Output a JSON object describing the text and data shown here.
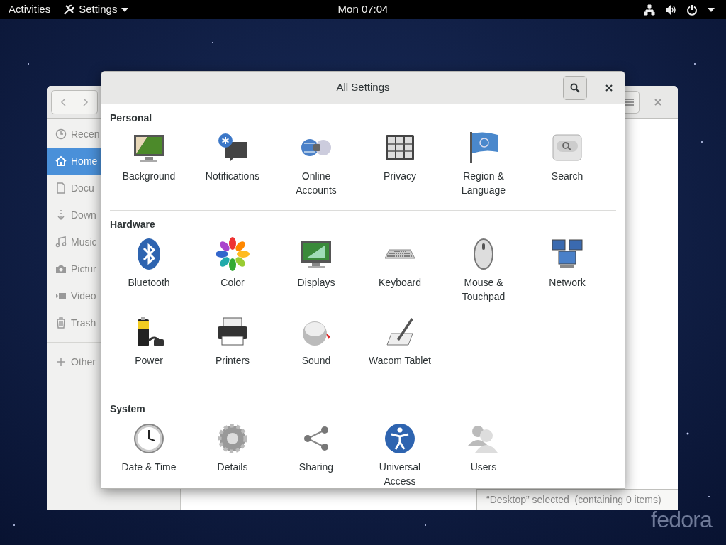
{
  "top_bar": {
    "activities": "Activities",
    "app_menu": "Settings",
    "clock": "Mon 07:04"
  },
  "files_window": {
    "sidebar": [
      {
        "label": "Recen",
        "selected": false
      },
      {
        "label": "Home",
        "selected": true
      },
      {
        "label": "Docu",
        "selected": false
      },
      {
        "label": "Down",
        "selected": false
      },
      {
        "label": "Music",
        "selected": false
      },
      {
        "label": "Pictur",
        "selected": false
      },
      {
        "label": "Video",
        "selected": false
      },
      {
        "label": "Trash",
        "selected": false
      },
      {
        "label": "Other",
        "selected": false
      }
    ],
    "status": "“Desktop” selected  (containing 0 items)"
  },
  "settings_dialog": {
    "title": "All Settings",
    "sections": [
      {
        "heading": "Personal",
        "items": [
          {
            "label": "Background"
          },
          {
            "label": "Notifications"
          },
          {
            "label": "Online Accounts"
          },
          {
            "label": "Privacy"
          },
          {
            "label": "Region & Language"
          },
          {
            "label": "Search"
          }
        ]
      },
      {
        "heading": "Hardware",
        "items": [
          {
            "label": "Bluetooth"
          },
          {
            "label": "Color"
          },
          {
            "label": "Displays"
          },
          {
            "label": "Keyboard"
          },
          {
            "label": "Mouse & Touchpad"
          },
          {
            "label": "Network"
          },
          {
            "label": "Power"
          },
          {
            "label": "Printers"
          },
          {
            "label": "Sound"
          },
          {
            "label": "Wacom Tablet"
          }
        ]
      },
      {
        "heading": "System",
        "items": [
          {
            "label": "Date & Time"
          },
          {
            "label": "Details"
          },
          {
            "label": "Sharing"
          },
          {
            "label": "Universal Access"
          },
          {
            "label": "Users"
          }
        ]
      }
    ]
  },
  "desktop": {
    "logo": "fedora"
  }
}
